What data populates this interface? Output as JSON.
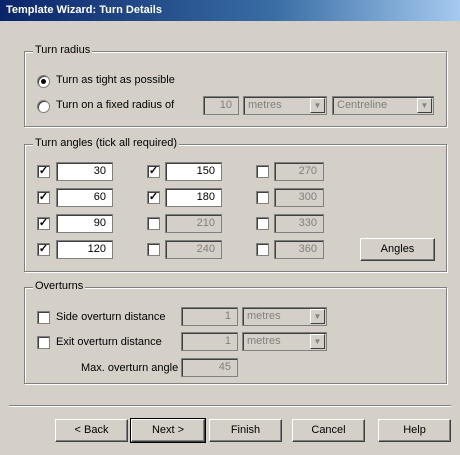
{
  "window": {
    "title": "Template Wizard: Turn Details"
  },
  "turn_radius": {
    "legend": "Turn radius",
    "option_tight": "Turn as tight as possible",
    "option_fixed": "Turn on a fixed radius of",
    "radius_value": "10",
    "unit": "metres",
    "reference": "Centreline"
  },
  "turn_angles": {
    "legend": "Turn angles (tick all required)",
    "angles": [
      {
        "value": "30",
        "checked": true
      },
      {
        "value": "60",
        "checked": true
      },
      {
        "value": "90",
        "checked": true
      },
      {
        "value": "120",
        "checked": true
      },
      {
        "value": "150",
        "checked": true
      },
      {
        "value": "180",
        "checked": true
      },
      {
        "value": "210",
        "checked": false
      },
      {
        "value": "240",
        "checked": false
      },
      {
        "value": "270",
        "checked": false
      },
      {
        "value": "300",
        "checked": false
      },
      {
        "value": "330",
        "checked": false
      },
      {
        "value": "360",
        "checked": false
      }
    ],
    "angles_button": "Angles"
  },
  "overturns": {
    "legend": "Overturns",
    "side_label": "Side overturn distance",
    "side_value": "1",
    "side_unit": "metres",
    "exit_label": "Exit overturn distance",
    "exit_value": "1",
    "exit_unit": "metres",
    "max_label": "Max. overturn angle",
    "max_value": "45"
  },
  "buttons": {
    "back": "< Back",
    "next": "Next >",
    "finish": "Finish",
    "cancel": "Cancel",
    "help": "Help"
  }
}
